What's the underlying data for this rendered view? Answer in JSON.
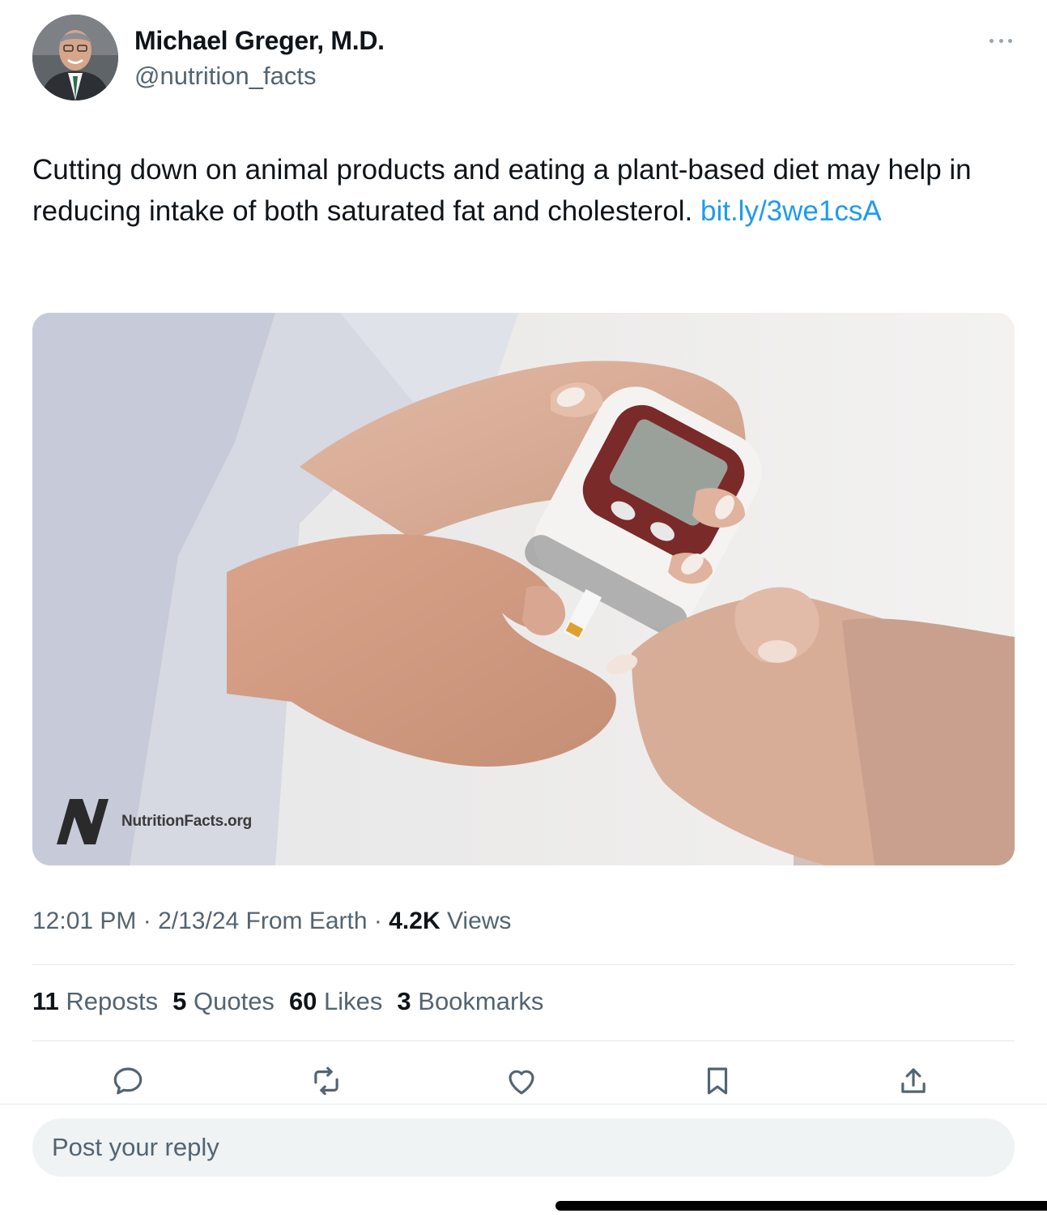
{
  "author": {
    "name": "Michael Greger, M.D.",
    "handle": "@nutrition_facts"
  },
  "tweet": {
    "text": "Cutting down on animal products and eating a plant-based diet may help in reducing intake of both saturated fat and cholesterol. ",
    "link_text": "bit.ly/​3we1csA"
  },
  "media": {
    "watermark": "NutritionFacts.org",
    "description_icon": "glucose-meter-photo"
  },
  "meta": {
    "time": "12:01 PM",
    "sep1": " · ",
    "date": "2/13/24",
    "source": " From Earth",
    "sep2": " · ",
    "views_count": "4.2K",
    "views_label": " Views"
  },
  "stats": {
    "reposts_count": "11",
    "reposts_label": " Reposts",
    "quotes_count": "5",
    "quotes_label": " Quotes",
    "likes_count": "60",
    "likes_label": " Likes",
    "bookmarks_count": "3",
    "bookmarks_label": " Bookmarks"
  },
  "actions": {
    "icons": [
      "reply-icon",
      "repost-icon",
      "like-icon",
      "bookmark-icon",
      "share-icon"
    ]
  },
  "reply": {
    "placeholder": "Post your reply"
  },
  "colors": {
    "link": "#1d9bf0",
    "secondary_text": "#536471",
    "primary_text": "#0f1419"
  }
}
